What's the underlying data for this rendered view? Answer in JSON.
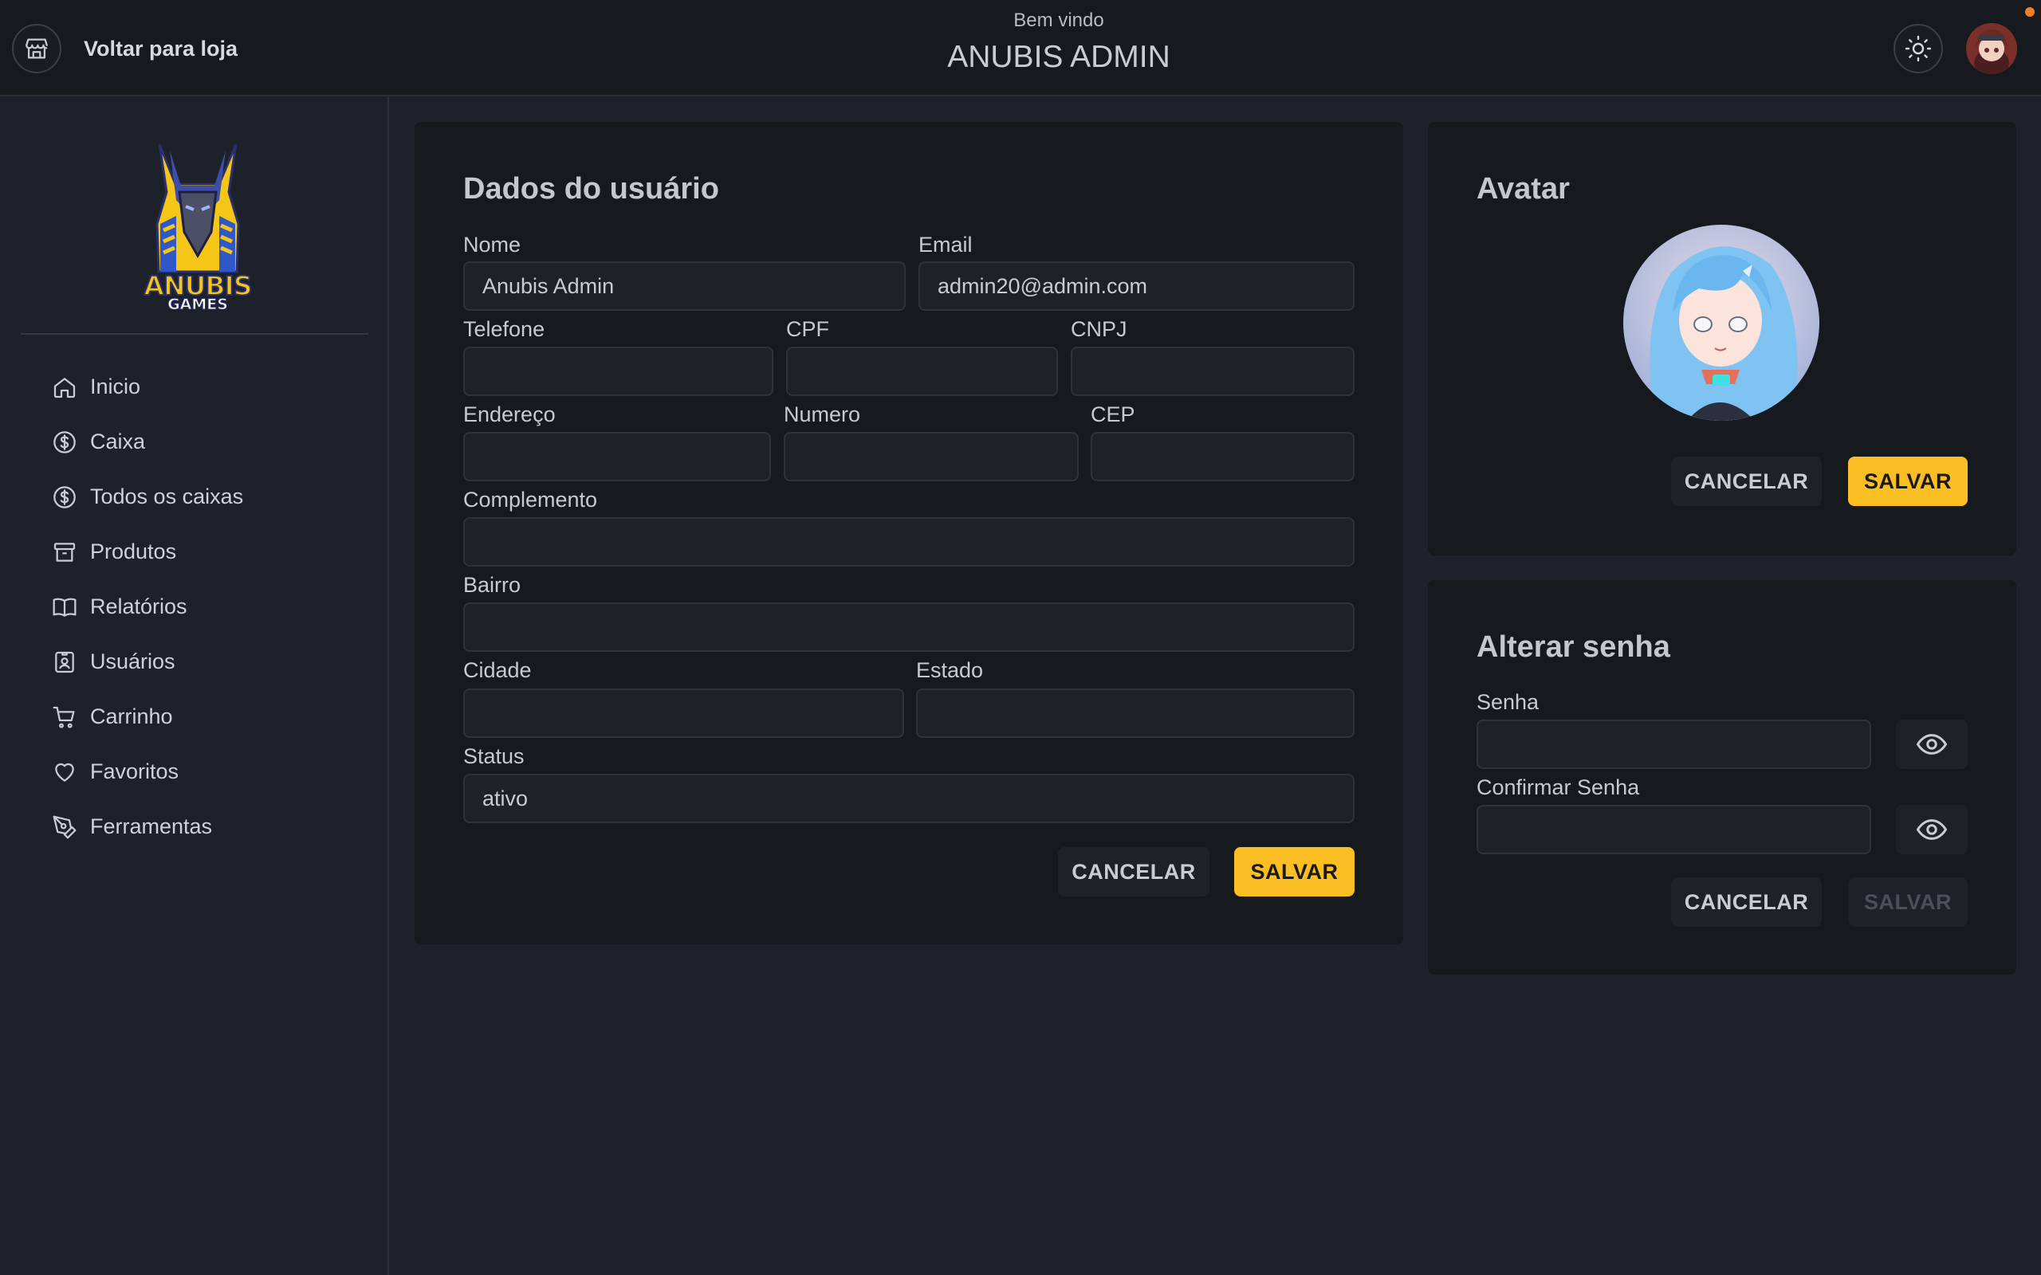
{
  "header": {
    "back_label": "Voltar para loja",
    "welcome": "Bem vindo",
    "admin_name": "ANUBIS ADMIN"
  },
  "sidebar": {
    "logo_text": [
      "ANUBIS",
      "GAMES"
    ],
    "items": [
      {
        "label": "Inicio",
        "icon": "home-icon"
      },
      {
        "label": "Caixa",
        "icon": "dollar-circle-icon"
      },
      {
        "label": "Todos os caixas",
        "icon": "dollar-circle-icon"
      },
      {
        "label": "Produtos",
        "icon": "archive-icon"
      },
      {
        "label": "Relatórios",
        "icon": "book-open-icon"
      },
      {
        "label": "Usuários",
        "icon": "user-badge-icon"
      },
      {
        "label": "Carrinho",
        "icon": "cart-icon"
      },
      {
        "label": "Favoritos",
        "icon": "heart-icon"
      },
      {
        "label": "Ferramentas",
        "icon": "pen-tool-icon"
      }
    ]
  },
  "user_form": {
    "title": "Dados do usuário",
    "labels": {
      "nome": "Nome",
      "email": "Email",
      "telefone": "Telefone",
      "cpf": "CPF",
      "cnpj": "CNPJ",
      "endereco": "Endereço",
      "numero": "Numero",
      "cep": "CEP",
      "complemento": "Complemento",
      "bairro": "Bairro",
      "cidade": "Cidade",
      "estado": "Estado",
      "status": "Status"
    },
    "values": {
      "nome": "Anubis Admin",
      "email": "admin20@admin.com",
      "telefone": "",
      "cpf": "",
      "cnpj": "",
      "endereco": "",
      "numero": "",
      "cep": "",
      "complemento": "",
      "bairro": "",
      "cidade": "",
      "estado": "",
      "status": "ativo"
    },
    "cancel_label": "CANCELAR",
    "save_label": "SALVAR"
  },
  "avatar_card": {
    "title": "Avatar",
    "cancel_label": "CANCELAR",
    "save_label": "SALVAR"
  },
  "password_card": {
    "title": "Alterar senha",
    "senha_label": "Senha",
    "confirmar_label": "Confirmar Senha",
    "senha_value": "",
    "confirmar_value": "",
    "cancel_label": "CANCELAR",
    "save_label": "SALVAR"
  },
  "colors": {
    "accent": "#fbbf24",
    "background": "#1d2129",
    "card": "#16191e",
    "notification": "#f07f2a"
  }
}
